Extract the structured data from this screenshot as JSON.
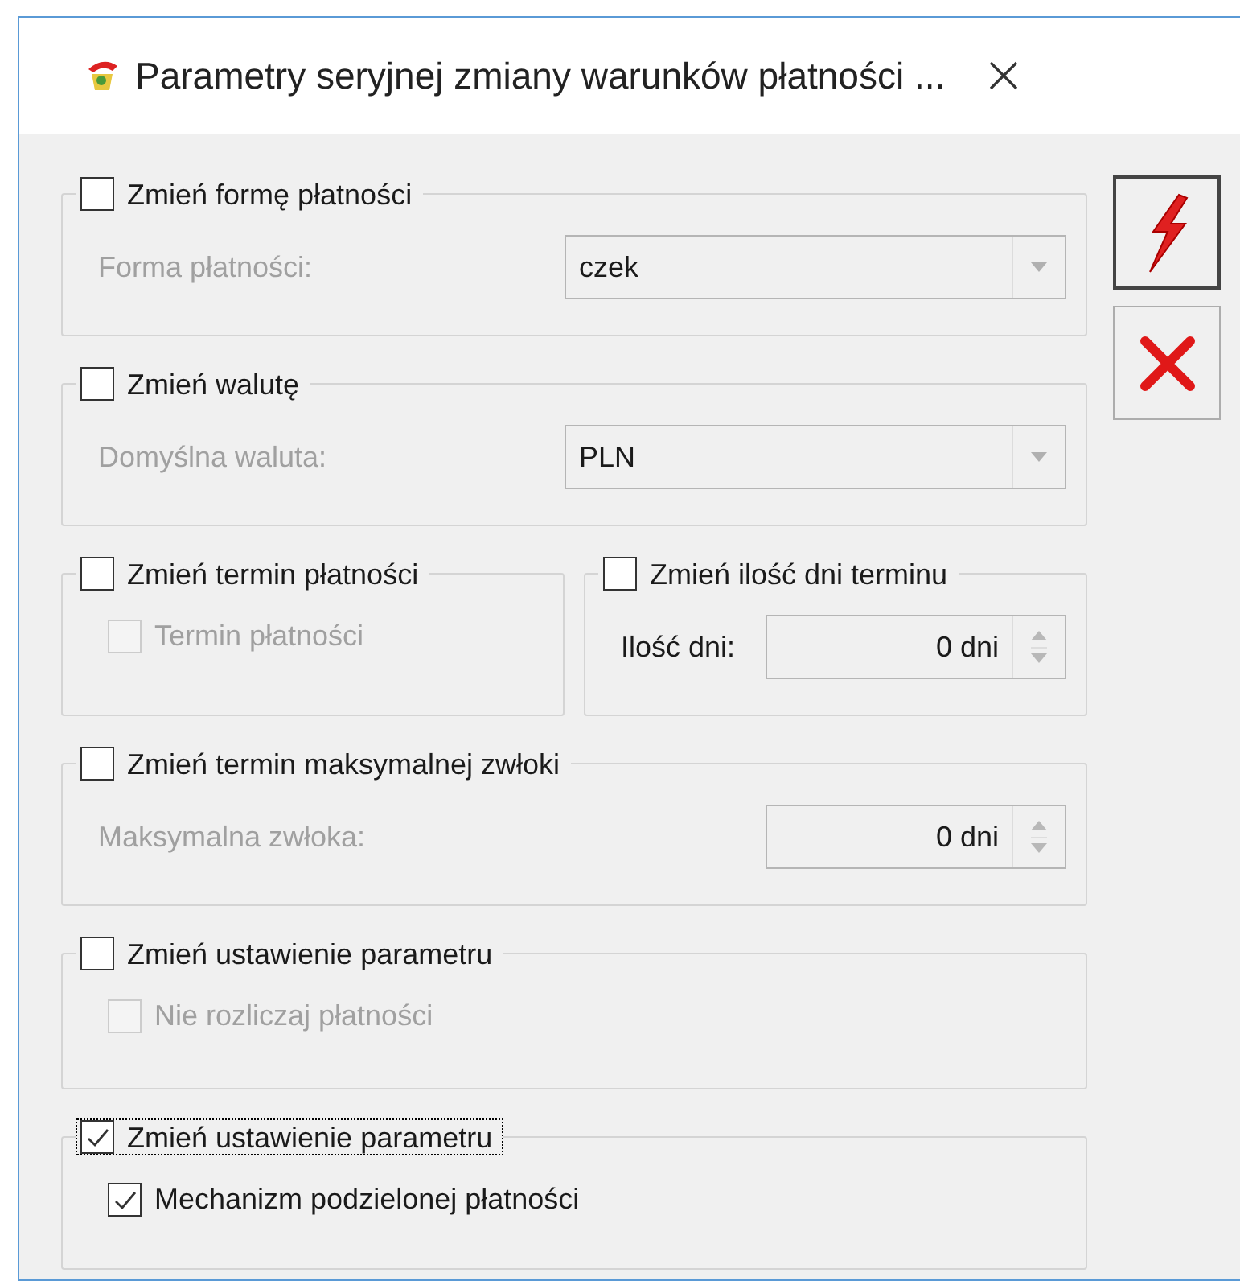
{
  "window": {
    "title": "Parametry seryjnej zmiany warunków płatności ..."
  },
  "rows": [
    [
      {
        "kind": "select",
        "label": "Zmień formę płatności",
        "checked": false,
        "focused": false,
        "field": {
          "label": "Forma płatności:",
          "value": "czek",
          "disabled": true
        }
      }
    ],
    [
      {
        "kind": "select",
        "label": "Zmień walutę",
        "checked": false,
        "focused": false,
        "field": {
          "label": "Domyślna waluta:",
          "value": "PLN",
          "disabled": true
        }
      }
    ],
    [
      {
        "kind": "option",
        "label": "Zmień termin płatności",
        "checked": false,
        "focused": false,
        "option": {
          "label": "Termin płatności",
          "checked": false,
          "disabled": true
        }
      },
      {
        "kind": "spin",
        "label": "Zmień ilość dni terminu",
        "checked": false,
        "focused": false,
        "field": {
          "label": "Ilość dni:",
          "value": "0 dni",
          "disabled": false
        }
      }
    ],
    [
      {
        "kind": "spin",
        "label": "Zmień termin maksymalnej zwłoki",
        "checked": false,
        "focused": false,
        "field": {
          "label": "Maksymalna zwłoka:",
          "value": "0 dni",
          "disabled": true
        }
      }
    ],
    [
      {
        "kind": "option",
        "label": "Zmień ustawienie parametru",
        "checked": false,
        "focused": false,
        "option": {
          "label": "Nie rozliczaj płatności",
          "checked": false,
          "disabled": true
        }
      }
    ],
    [
      {
        "kind": "option",
        "label": "Zmień ustawienie parametru",
        "checked": true,
        "focused": true,
        "option": {
          "label": "Mechanizm podzielonej płatności",
          "checked": true,
          "disabled": false
        }
      }
    ]
  ]
}
